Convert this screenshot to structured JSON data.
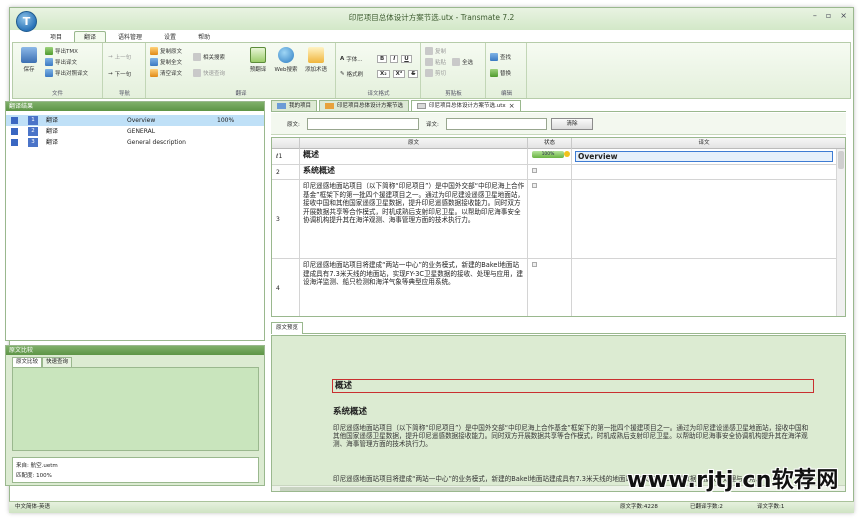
{
  "window": {
    "title": "印尼项目总体设计方案节选.utx - Transmate 7.2",
    "controls": [
      "–",
      "▫",
      "×"
    ],
    "orb_letter": "T"
  },
  "menu": {
    "tabs": [
      "项目",
      "翻译",
      "语料管理",
      "设置",
      "帮助"
    ],
    "active": "翻译"
  },
  "ribbon": {
    "file": {
      "label": "文件",
      "save": "保存",
      "export_tmx": "导出TMX",
      "export_translation": "导出译文",
      "export_bilingual": "导出对照译文"
    },
    "nav": {
      "label": "导航",
      "prev": "上一句",
      "next": "下一句"
    },
    "translate": {
      "label": "翻译",
      "copy_source": "复制原文",
      "copy_all": "复制全文",
      "clear_target": "清空译文",
      "related_search": "相关搜索",
      "quick_query": "快速查询",
      "pre_translate": "预翻译",
      "web_search": "Web搜索",
      "add_term": "添加术语"
    },
    "format": {
      "label": "译文格式",
      "font": "字体...",
      "painter": "格式刷",
      "b": "B",
      "i": "I",
      "u": "U",
      "sub": "X₂",
      "sup": "X²",
      "s": "S"
    },
    "clipboard": {
      "label": "剪贴板",
      "copy": "复制",
      "paste": "粘贴",
      "select_all": "全选",
      "cut": "剪切"
    },
    "edit": {
      "label": "编辑",
      "find": "查找",
      "replace": "替换"
    }
  },
  "search_results": {
    "title": "翻译结果",
    "rows": [
      {
        "num": "1",
        "type": "翻译",
        "text": "Overview",
        "score": "100%"
      },
      {
        "num": "2",
        "type": "翻译",
        "text": "GENERAL",
        "score": ""
      },
      {
        "num": "3",
        "type": "翻译",
        "text": "General description",
        "score": ""
      }
    ]
  },
  "compare": {
    "title": "原文比较",
    "tabs": [
      "原文比较",
      "快速查询"
    ],
    "source_label": "来自:",
    "source_value": "航空.uetm",
    "match_label": "匹配度:",
    "match_value": "100%"
  },
  "doc_tabs": [
    {
      "label": "我的项目",
      "active": false
    },
    {
      "label": "印尼项目总体设计方案节选",
      "active": false
    },
    {
      "label": "印尼项目总体设计方案节选.utx",
      "active": true,
      "close": "×"
    }
  ],
  "filter": {
    "source_label": "原文:",
    "target_label": "译文:",
    "clear_button": "清除"
  },
  "grid": {
    "headers": {
      "no": "",
      "source": "原文",
      "status": "状态",
      "target": "译文"
    },
    "rows": [
      {
        "no": "1",
        "source": "概述",
        "target": "Overview",
        "heading": true,
        "status": "pill"
      },
      {
        "no": "2",
        "source": "系统概述",
        "target": "",
        "heading": true,
        "status": "box"
      },
      {
        "no": "3",
        "source": "印尼遥感地面站项目（以下简称“印尼项目”）是中国外交部“中印尼海上合作基金”框架下的第一批四个援建项目之一。通过为印尼建设遥感卫星地面站，接收中国和其他国家遥感卫星数据，提升印尼遥感数据接收能力。同时双方开展数据共享等合作模式，时机成熟后支射印尼卫星。以帮助印尼海事安全协调机构提升其在海洋观测、海事管理方面的技术执行力。",
        "target": "",
        "heading": false,
        "status": "box"
      },
      {
        "no": "4",
        "source": "印尼遥感地面站项目将建成“两站一中心”的业务模式，新建的Bakel地面站建成具有7.3米天线的地面站，实现FY-3C卫星数据的接收、处理与应用，建设海洋监测、船只检测和海洋气象等典型应用系统。",
        "target": "",
        "heading": false,
        "status": "box"
      }
    ],
    "status_pill_text": "100%"
  },
  "preview": {
    "tab": "原文预览",
    "h1": "概述",
    "h2": "系统概述",
    "p1": "印尼遥感地面站项目（以下简称“印尼项目”）是中国外交部“中印尼海上合作基金”框架下的第一批四个援建项目之一。通过为印尼建设遥感卫星地面站，接收中国和其他国家遥感卫星数据，提升印尼遥感数据接收能力。同时双方开展数据共享等合作模式，时机成熟后支射印尼卫星。以帮助印尼海事安全协调机构提升其在海洋观测、海事管理方面的技术执行力。",
    "p2": "印尼遥感地面站项目将建成“两站一中心”的业务模式，新建的Bakel地面站建成具有7.3米天线的地面站，实现FY-3C卫星数据的接收、处理与应用。"
  },
  "status": {
    "lang": "中文简体-英语",
    "source_chars": "原文字数:4228",
    "translated_chars": "已翻译字数:2",
    "target_chars": "译文字数:1"
  },
  "watermark": "www.rjtj.cn软荐网"
}
